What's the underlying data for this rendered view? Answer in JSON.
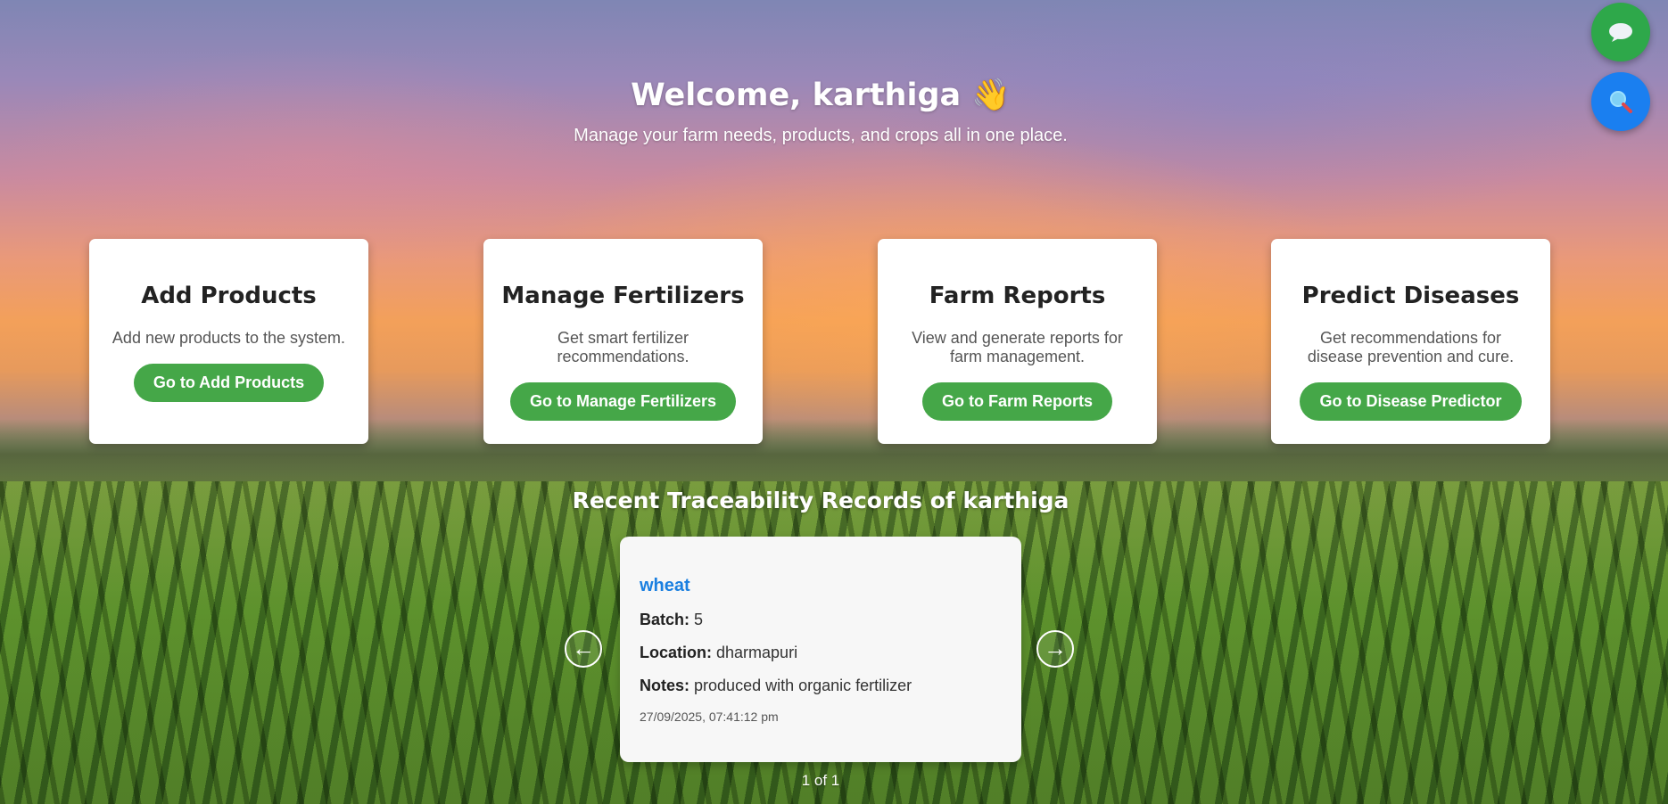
{
  "header": {
    "welcome": "Welcome, karthiga 👋",
    "subtitle": "Manage your farm needs, products, and crops all in one place."
  },
  "cards": [
    {
      "title": "Add Products",
      "description": "Add new products to the system.",
      "button": "Go to Add Products"
    },
    {
      "title": "Manage Fertilizers",
      "description": "Get smart fertilizer recommendations.",
      "button": "Go to Manage Fertilizers"
    },
    {
      "title": "Farm Reports",
      "description": "View and generate reports for farm management.",
      "button": "Go to Farm Reports"
    },
    {
      "title": "Predict Diseases",
      "description": "Get recommendations for disease prevention and cure.",
      "button": "Go to Disease Predictor"
    }
  ],
  "records": {
    "title": "Recent Traceability Records of karthiga",
    "current": {
      "crop": "wheat",
      "batch_label": "Batch:",
      "batch": "5",
      "location_label": "Location:",
      "location": "dharmapuri",
      "notes_label": "Notes:",
      "notes": "produced with organic fertilizer",
      "timestamp": "27/09/2025, 07:41:12 pm"
    },
    "prev_icon": "←",
    "next_icon": "→",
    "pager": "1 of 1"
  },
  "fabs": {
    "chat_icon": "chat-bubble-icon",
    "search_icon": "magnifier-icon",
    "chat_color": "#2ea84a",
    "search_color": "#1a7ff0"
  },
  "colors": {
    "primary_button": "#45a748",
    "crop_link": "#1a7fe0"
  }
}
